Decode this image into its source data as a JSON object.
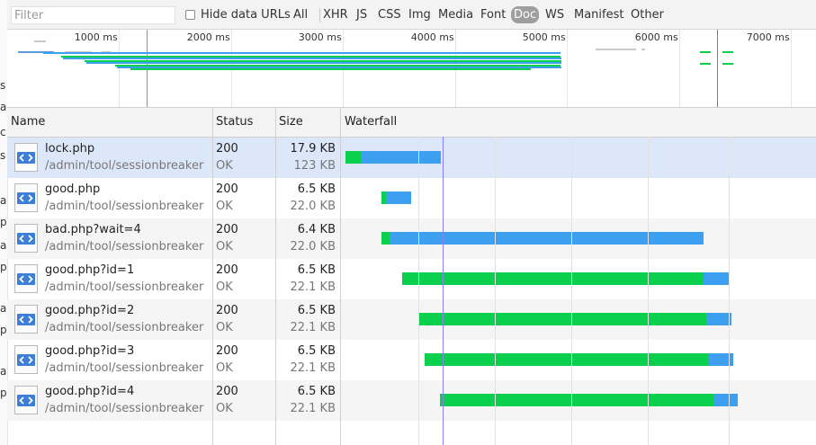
{
  "filter": {
    "placeholder": "Filter"
  },
  "hide_data_urls_label": "Hide data URLs",
  "type_filters": [
    {
      "label": "All",
      "active": false
    },
    {
      "label": "XHR",
      "active": false
    },
    {
      "label": "JS",
      "active": false
    },
    {
      "label": "CSS",
      "active": false
    },
    {
      "label": "Img",
      "active": false
    },
    {
      "label": "Media",
      "active": false
    },
    {
      "label": "Font",
      "active": false
    },
    {
      "label": "Doc",
      "active": true
    },
    {
      "label": "WS",
      "active": false
    },
    {
      "label": "Manifest",
      "active": false
    },
    {
      "label": "Other",
      "active": false
    }
  ],
  "overview": {
    "ticks": [
      "1000 ms",
      "2000 ms",
      "3000 ms",
      "4000 ms",
      "5000 ms",
      "6000 ms",
      "7000 ms"
    ]
  },
  "columns": {
    "name": "Name",
    "status": "Status",
    "size": "Size",
    "waterfall": "Waterfall"
  },
  "requests": [
    {
      "name": "lock.php",
      "path": "/admin/tool/sessionbreaker",
      "status": "200",
      "status_text": "OK",
      "size": "17.9 KB",
      "resource": "123 KB",
      "selected": true
    },
    {
      "name": "good.php",
      "path": "/admin/tool/sessionbreaker",
      "status": "200",
      "status_text": "OK",
      "size": "6.5 KB",
      "resource": "22.0 KB",
      "selected": false
    },
    {
      "name": "bad.php?wait=4",
      "path": "/admin/tool/sessionbreaker",
      "status": "200",
      "status_text": "OK",
      "size": "6.4 KB",
      "resource": "22.0 KB",
      "selected": false
    },
    {
      "name": "good.php?id=1",
      "path": "/admin/tool/sessionbreaker",
      "status": "200",
      "status_text": "OK",
      "size": "6.5 KB",
      "resource": "22.1 KB",
      "selected": false
    },
    {
      "name": "good.php?id=2",
      "path": "/admin/tool/sessionbreaker",
      "status": "200",
      "status_text": "OK",
      "size": "6.5 KB",
      "resource": "22.1 KB",
      "selected": false
    },
    {
      "name": "good.php?id=3",
      "path": "/admin/tool/sessionbreaker",
      "status": "200",
      "status_text": "OK",
      "size": "6.5 KB",
      "resource": "22.1 KB",
      "selected": false
    },
    {
      "name": "good.php?id=4",
      "path": "/admin/tool/sessionbreaker",
      "status": "200",
      "status_text": "OK",
      "size": "6.5 KB",
      "resource": "22.1 KB",
      "selected": false
    }
  ],
  "colors": {
    "waiting": "#0bd04e",
    "download": "#3c9ff0",
    "dom_content_loaded": "#8b7ff5",
    "load": "#e0534a"
  },
  "left_page_fragments": [
    "s",
    "a",
    "c",
    "s",
    "a",
    "p",
    "a",
    "p",
    "a",
    "p",
    "a",
    "p"
  ]
}
